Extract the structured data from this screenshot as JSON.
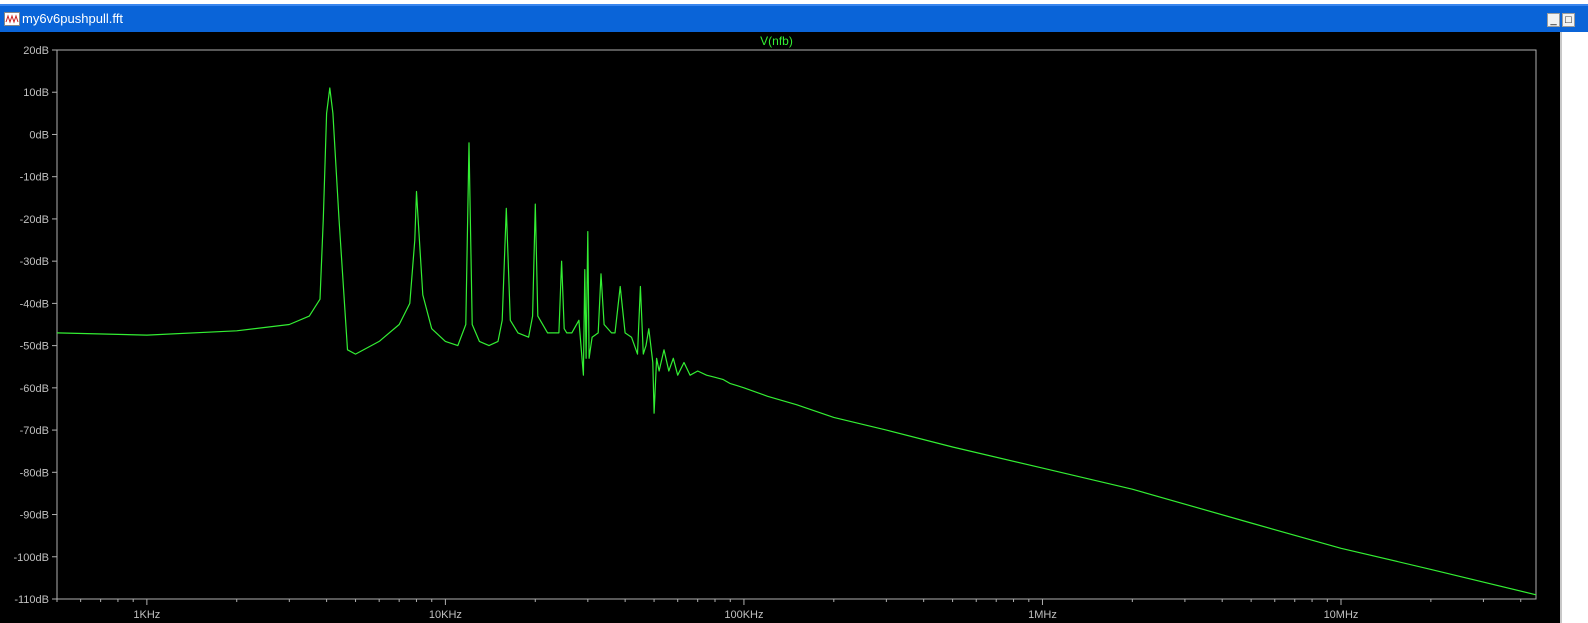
{
  "window": {
    "title": "my6v6pushpull.fft",
    "minimize_label": "_",
    "maximize_label": "□"
  },
  "colors": {
    "titlebar": "#0a64d8",
    "plot_background": "#000000",
    "frame": "#b0b0b0",
    "tick_text": "#c0c0c0",
    "trace": "#33ee33"
  },
  "chart_data": {
    "type": "line",
    "title": "V(nfb)",
    "xscale": "log",
    "xlim": [
      500,
      45000000
    ],
    "ylim": [
      -110,
      20
    ],
    "grid": false,
    "yticks": [
      20,
      10,
      0,
      -10,
      -20,
      -30,
      -40,
      -50,
      -60,
      -70,
      -80,
      -90,
      -100,
      -110
    ],
    "ytick_labels": [
      "20dB",
      "10dB",
      "0dB",
      "-10dB",
      "-20dB",
      "-30dB",
      "-40dB",
      "-50dB",
      "-60dB",
      "-70dB",
      "-80dB",
      "-90dB",
      "-100dB",
      "-110dB"
    ],
    "xticks": [
      1000,
      10000,
      100000,
      1000000,
      10000000
    ],
    "xtick_labels": [
      "1KHz",
      "10KHz",
      "100KHz",
      "1MHz",
      "10MHz"
    ],
    "series": [
      {
        "name": "V(nfb)",
        "color": "#33ee33",
        "x": [
          500,
          1000,
          2000,
          3000,
          3500,
          3800,
          3900,
          4000,
          4100,
          4200,
          4400,
          4700,
          5000,
          6000,
          7000,
          7600,
          7900,
          8000,
          8100,
          8400,
          9000,
          10000,
          11000,
          11700,
          12000,
          12300,
          13000,
          14000,
          15000,
          15500,
          16000,
          16500,
          17500,
          19000,
          19600,
          20000,
          20400,
          22000,
          24000,
          24500,
          25000,
          25500,
          26500,
          28000,
          29000,
          29300,
          29600,
          30000,
          30300,
          31000,
          32500,
          33200,
          34000,
          36000,
          37000,
          38500,
          40000,
          42000,
          44000,
          45000,
          46000,
          47000,
          48000,
          49500,
          50000,
          51000,
          52000,
          54000,
          56000,
          58000,
          60000,
          63000,
          66000,
          70000,
          75000,
          80000,
          85000,
          90000,
          95000,
          100000,
          120000,
          150000,
          200000,
          300000,
          500000,
          1000000,
          2000000,
          5000000,
          10000000,
          20000000,
          45000000
        ],
        "y": [
          -47,
          -47.5,
          -46.5,
          -45,
          -43,
          -39,
          -20,
          5,
          11,
          5,
          -20,
          -51,
          -52,
          -49,
          -45,
          -40,
          -25,
          -13.5,
          -20,
          -38,
          -46,
          -49,
          -50,
          -45,
          -2,
          -45,
          -49,
          -50,
          -49,
          -44,
          -17.5,
          -44,
          -47,
          -48,
          -43,
          -16.5,
          -43,
          -47,
          -47,
          -30,
          -46,
          -47,
          -47,
          -44,
          -57,
          -32,
          -53,
          -23,
          -53,
          -48,
          -47,
          -33,
          -45,
          -47,
          -47,
          -36,
          -47,
          -48,
          -52,
          -36,
          -52,
          -50,
          -46,
          -54,
          -66,
          -53,
          -56,
          -51,
          -56,
          -53,
          -57,
          -54,
          -57,
          -56,
          -57,
          -57.5,
          -58,
          -59,
          -59.5,
          -60,
          -62,
          -64,
          -67,
          -70,
          -74,
          -79,
          -84,
          -92,
          -98,
          -103,
          -109
        ]
      }
    ]
  }
}
